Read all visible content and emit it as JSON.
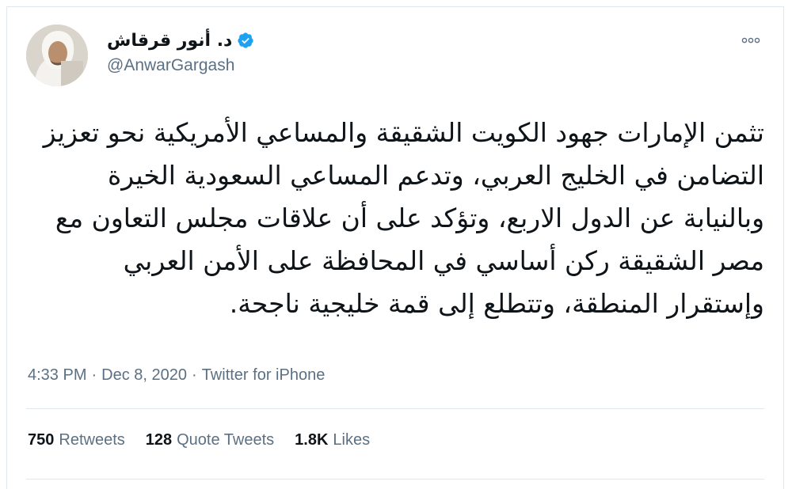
{
  "tweet": {
    "author": {
      "display_name": "د. أنور قرقاش",
      "handle": "@AnwarGargash",
      "verified": true,
      "verified_icon": "verified-badge-icon",
      "avatar_icon": "profile-photo"
    },
    "more_icon": "more-options-icon",
    "text": "تثمن الإمارات جهود الكويت الشقيقة والمساعي الأمريكية نحو تعزيز التضامن في الخليج العربي، وتدعم المساعي السعودية الخيرة وبالنيابة عن الدول الاربع، وتؤكد على أن علاقات مجلس التعاون مع مصر الشقيقة ركن أساسي في المحافظة على الأمن العربي وإستقرار المنطقة، وتتطلع إلى قمة خليجية ناجحة.",
    "time": "4:33 PM",
    "separator": "·",
    "date": "Dec 8, 2020",
    "source": "Twitter for iPhone",
    "stats": [
      {
        "count": "750",
        "label": "Retweets"
      },
      {
        "count": "128",
        "label": "Quote Tweets"
      },
      {
        "count": "1.8K",
        "label": "Likes"
      }
    ],
    "colors": {
      "verified": "#1da1f2",
      "secondary_text": "#5b7083",
      "border": "#e1e8ed"
    }
  }
}
